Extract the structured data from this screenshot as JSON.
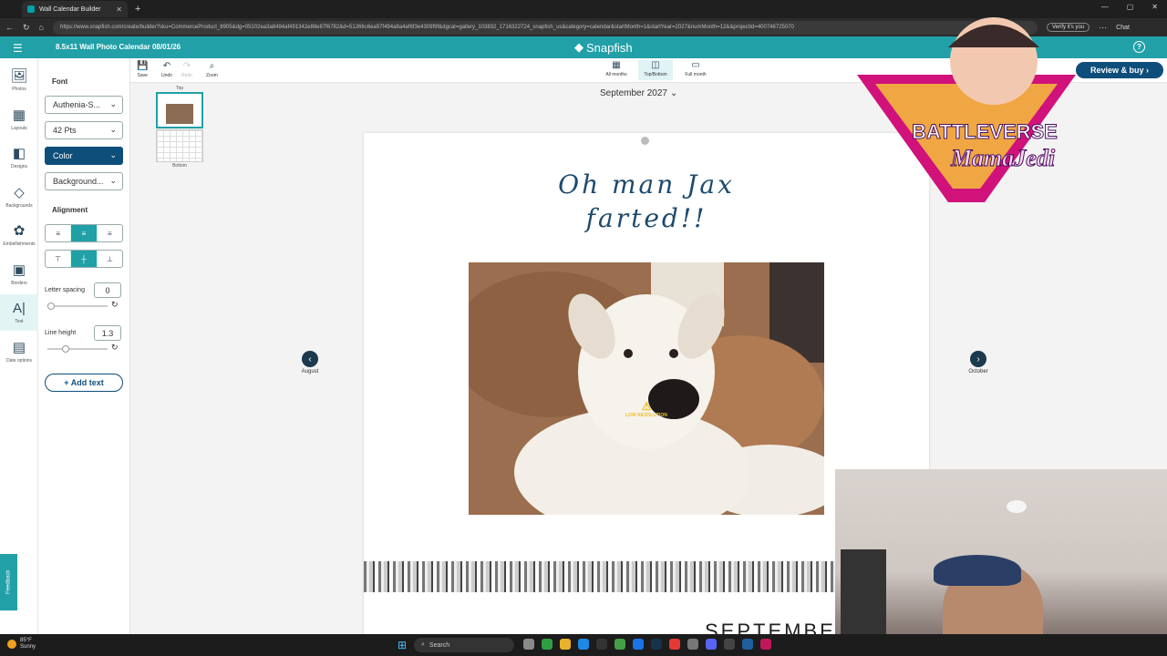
{
  "browser": {
    "tab_title": "Wall Calendar Builder",
    "url": "https://www.snapfish.com/create/builder?sku=CommerceProduct_8905&dg=05102ea3a8494af491342e88e87f6782&d=51266c6ea97f494a8a4af6f3e4309f9f&dgcat=gallery_103832_1716322724_snapfish_us&category=calendar&startMonth=1&startYear=2027&numMonth=12&&projectId=400746725070",
    "verify_label": "Verify it's you",
    "chat_label": "Chat"
  },
  "app": {
    "project_title": "8.5x11 Wall Photo Calendar 08/01/26",
    "brand": "Snapfish",
    "review_label": "Review & buy ›"
  },
  "rail": {
    "items": [
      {
        "label": "Photos"
      },
      {
        "label": "Layouts"
      },
      {
        "label": "Designs"
      },
      {
        "label": "Backgrounds"
      },
      {
        "label": "Embellishments"
      },
      {
        "label": "Borders"
      },
      {
        "label": "Text"
      },
      {
        "label": "Date options"
      }
    ]
  },
  "panel": {
    "font_heading": "Font",
    "font_value": "Authenia-S...",
    "size_value": "42 Pts",
    "color_label": "Color",
    "background_label": "Background...",
    "alignment_heading": "Alignment",
    "letter_spacing_label": "Letter spacing",
    "letter_spacing_value": "0",
    "line_height_label": "Line height",
    "line_height_value": "1.3",
    "add_text_label": "+ Add text"
  },
  "toolbar": {
    "save": "Save",
    "undo": "Undo",
    "redo": "Redo",
    "zoom": "Zoom",
    "views": [
      {
        "label": "All months"
      },
      {
        "label": "Top/Bottom"
      },
      {
        "label": "Full month"
      }
    ]
  },
  "thumbs": {
    "top_label": "Top",
    "bottom_label": "Bottom"
  },
  "canvas": {
    "month_select": "September 2027",
    "caption_line1": "Oh man Jax",
    "caption_line2": "farted!!",
    "low_res_label": "LOW RESOLUTION",
    "bottom_month": "SEPTEMBER",
    "prev_month": "August",
    "next_month": "October"
  },
  "feedback_label": "Feedback",
  "taskbar": {
    "temperature": "85°F",
    "condition": "Sunny",
    "search_label": "Search"
  },
  "colors": {
    "brand_teal": "#21a0a8",
    "navy": "#0e4e7a",
    "caption_blue": "#1c4a6e"
  },
  "overlay": {
    "logo_line1": "BATTLEVERSE",
    "logo_line2": "MamaJedi"
  }
}
